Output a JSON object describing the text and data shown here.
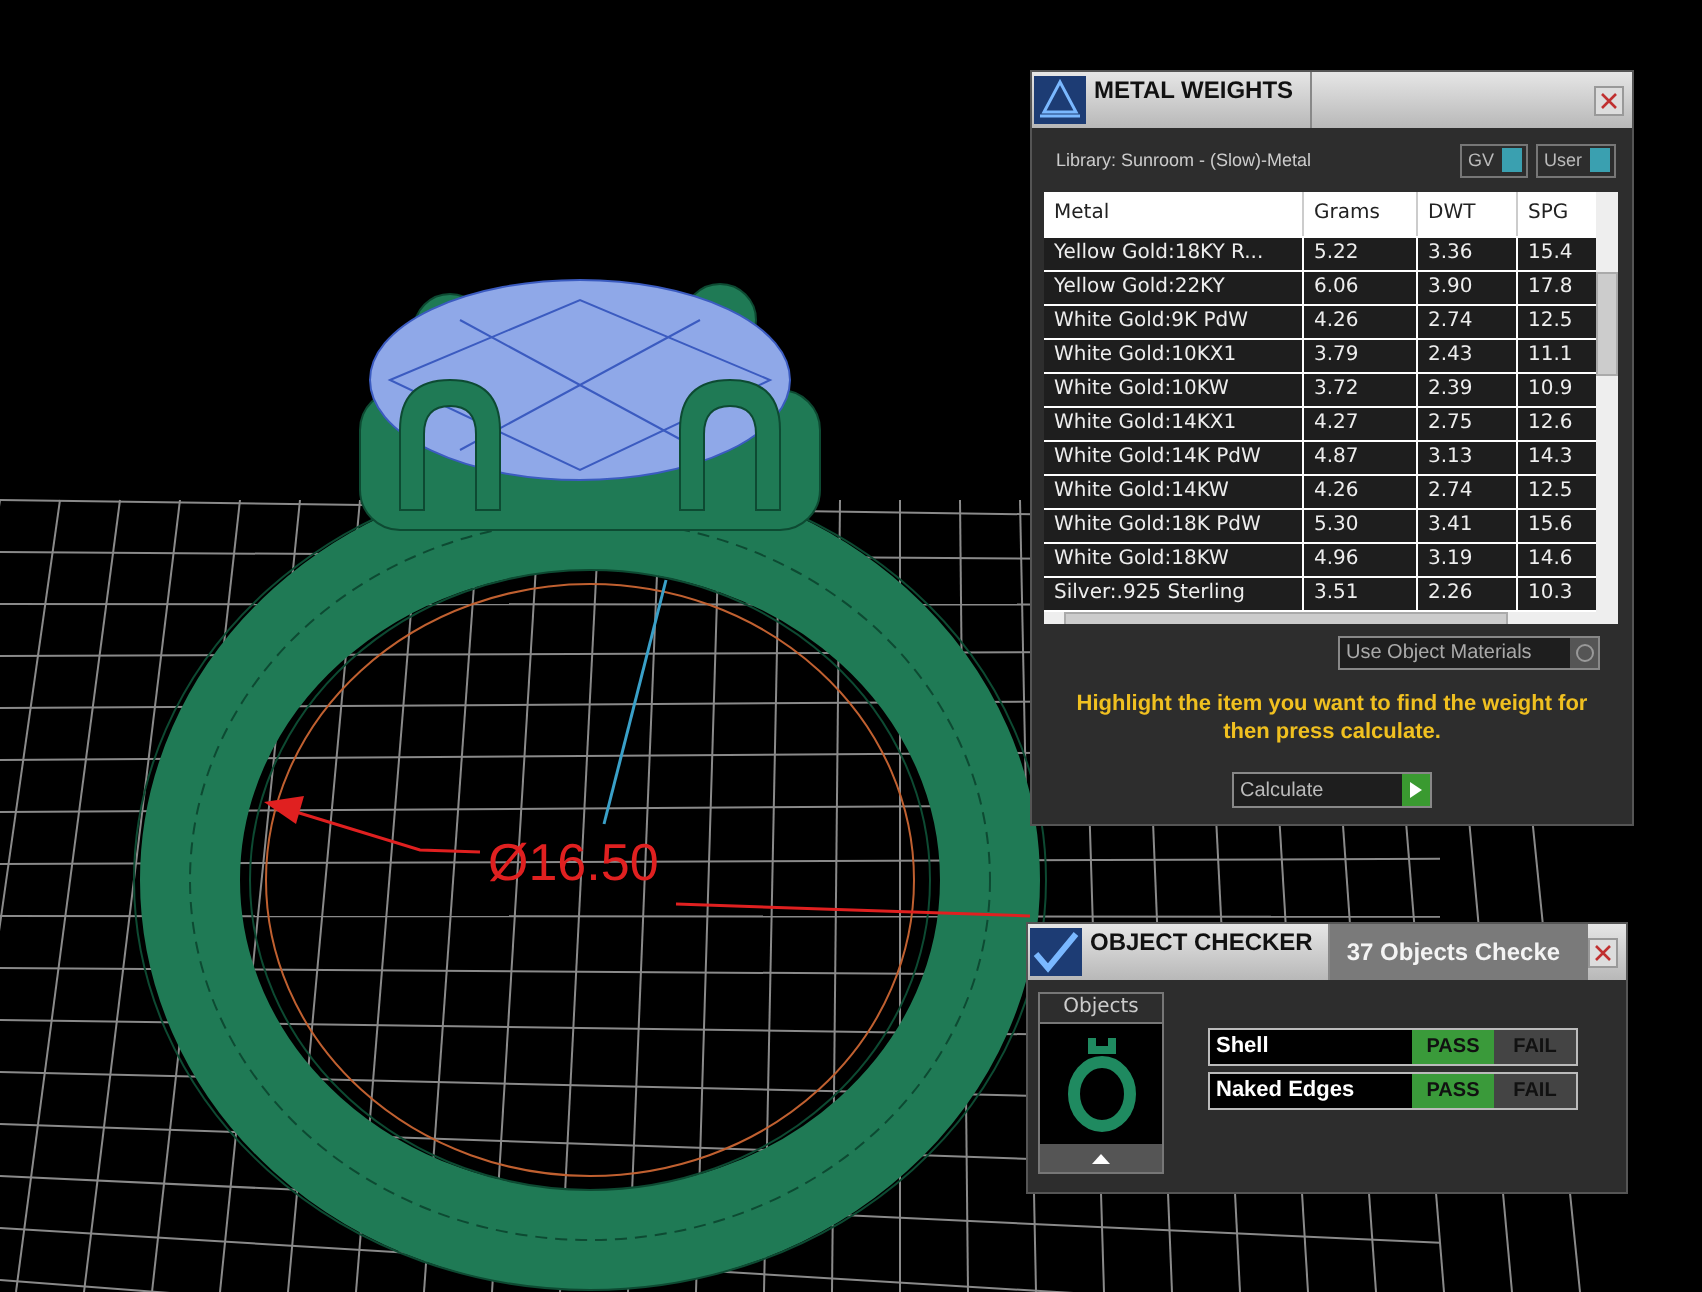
{
  "viewport": {
    "dimension": "Ø16.50"
  },
  "metal_weights": {
    "title": "METAL WEIGHTS",
    "library": "Library: Sunroom - (Slow)-Metal",
    "toggles": [
      {
        "label": "GV",
        "on": true
      },
      {
        "label": "User",
        "on": true
      }
    ],
    "table": {
      "columns": [
        "Metal",
        "Grams",
        "DWT",
        "SPG"
      ],
      "rows": [
        [
          "Yellow Gold:18KY R...",
          "5.22",
          "3.36",
          "15.4"
        ],
        [
          "Yellow Gold:22KY",
          "6.06",
          "3.90",
          "17.8"
        ],
        [
          "White Gold:9K PdW",
          "4.26",
          "2.74",
          "12.5"
        ],
        [
          "White Gold:10KX1",
          "3.79",
          "2.43",
          "11.1"
        ],
        [
          "White Gold:10KW",
          "3.72",
          "2.39",
          "10.9"
        ],
        [
          "White Gold:14KX1",
          "4.27",
          "2.75",
          "12.6"
        ],
        [
          "White Gold:14K PdW",
          "4.87",
          "3.13",
          "14.3"
        ],
        [
          "White Gold:14KW",
          "4.26",
          "2.74",
          "12.5"
        ],
        [
          "White Gold:18K PdW",
          "5.30",
          "3.41",
          "15.6"
        ],
        [
          "White Gold:18KW",
          "4.96",
          "3.19",
          "14.6"
        ],
        [
          "Silver:.925 Sterling",
          "3.51",
          "2.26",
          "10.3"
        ]
      ]
    },
    "use_object_materials": {
      "label": "Use Object Materials",
      "checked": false
    },
    "message": "Highlight the item you want to find the weight for then press calculate.",
    "calculate_button": "Calculate"
  },
  "object_checker": {
    "title": "OBJECT CHECKER",
    "status": "37  Objects Checke",
    "objects_label": "Objects",
    "checks": [
      {
        "name": "Shell",
        "passed": true,
        "pass_label": "PASS",
        "fail_label": "FAIL"
      },
      {
        "name": "Naked Edges",
        "passed": true,
        "pass_label": "PASS",
        "fail_label": "FAIL"
      }
    ]
  }
}
